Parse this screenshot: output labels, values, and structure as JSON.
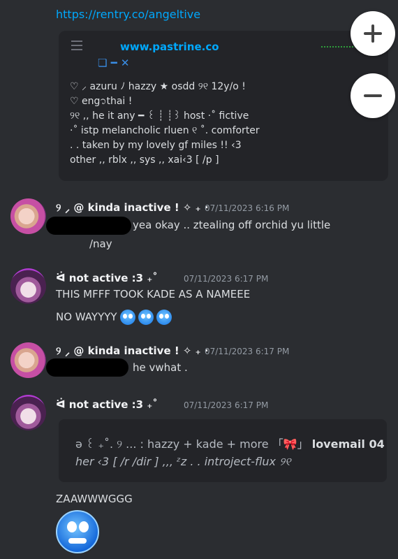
{
  "top_link": "https://rentry.co/angeltive",
  "embed": {
    "site": "www.pastrine.co",
    "bio_lines": [
      "♡ ⸝ azuru ﾉ hazzy ★ osdd ୨୧ 12y/o !",
      "♡ eng᭡thai !",
      "୨୧ ,, he it any ━ ꒰ ┊ ┊꒱ host ·˚ fictive",
      "·˚ istp melancholic rluen ୧ ˚. comforter",
      " .  . taken by my lovely gf miles !! ‹3",
      "other ,, rblx ,, sys ,, xai‹3 [ /p ]"
    ]
  },
  "zoom": {
    "plus": "+",
    "minus": "−"
  },
  "messages": [
    {
      "username": "୨ ⸝ @ kinda inactive ! ✧ ₊ ·",
      "timestamp": "07/11/2023 6:16 PM",
      "line1": "yea okay .. ztealing off orchid yu little",
      "line2": "/nay"
    },
    {
      "username": "ᐛ    not active :3    ₊˚",
      "timestamp": "07/11/2023 6:17 PM",
      "line1": "THIS MFFF TOOK KADE AS A NAMEEE",
      "line2": "NO WAYYYY"
    },
    {
      "username": "୨ ⸝ @ kinda inactive ! ✧ ₊ ·",
      "timestamp": "07/11/2023 6:17 PM",
      "line1": "he vwhat ."
    },
    {
      "username": "ᐛ    not active :3    ₊˚",
      "timestamp": "07/11/2023 6:17 PM",
      "embed_line1_a": "ə ꒰ ₊˚. ୨ ... : hazzy + kade + more 「🎀」 ",
      "embed_line1_b": "lovemail 04",
      "embed_line2": "her ‹3 [ /r /dir ] ,,, ᶻz . . introject-flux ୨୧"
    }
  ],
  "last_message": "ZAAWWWGGG",
  "colors": {
    "link": "#00a8fc",
    "background": "#2b2d31",
    "embed_bg": "#232428"
  }
}
